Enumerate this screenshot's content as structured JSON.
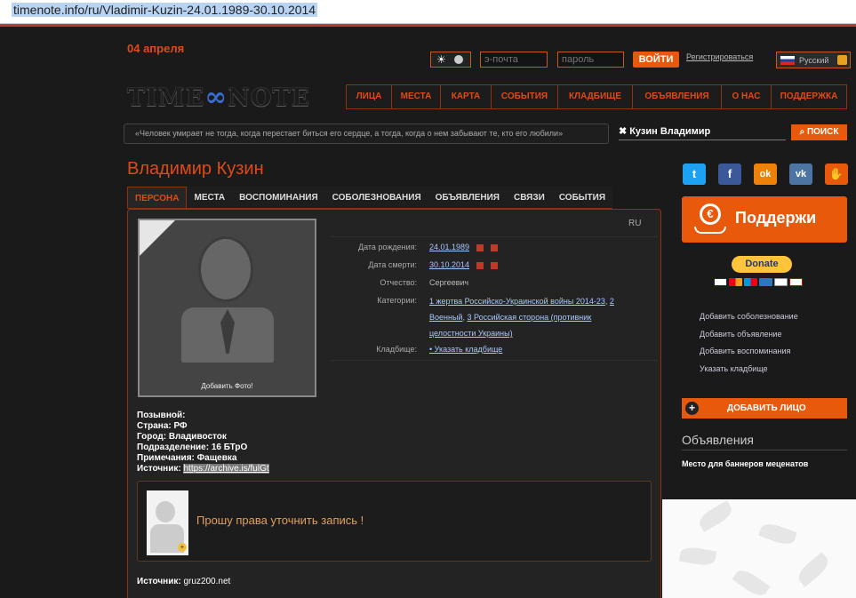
{
  "browser": {
    "url": "timenote.info/ru/Vladimir-Kuzin-24.01.1989-30.10.2014"
  },
  "header": {
    "date": "04 апреля",
    "email_placeholder": "э-почта",
    "password_placeholder": "пароль",
    "login_label": "ВОЙТИ",
    "register_label": "Регистрироваться",
    "language": "Русский",
    "logo_left": "TIME",
    "logo_symbol": "∞",
    "logo_right": "NOTE"
  },
  "nav": [
    "ЛИЦА",
    "МЕСТА",
    "КАРТА",
    "СОБЫТИЯ",
    "КЛАДБИЩЕ",
    "ОБЪЯВЛЕНИЯ",
    "О НАС",
    "ПОДДЕРЖКА"
  ],
  "quote": "«Человек умирает не тогда, когда перестает биться его сердце, а тогда, когда о нем забывают те, кто его любили»",
  "search": {
    "value": "Кузин Владимир",
    "button": "ПОИСК",
    "clear_icon": "x-icon"
  },
  "person": {
    "name": "Владимир Кузин",
    "tabs": [
      "ПЕРСОНА",
      "МЕСТА",
      "ВОСПОМИНАНИЯ",
      "СОБОЛЕЗНОВАНИЯ",
      "ОБЪЯВЛЕНИЯ",
      "СВЯЗИ",
      "СОБЫТИЯ"
    ],
    "lang": "RU",
    "add_photo": "Добавить Фото!",
    "fields": {
      "birth_label": "Дата рождения:",
      "birth": "24.01.1989",
      "death_label": "Дата смерти:",
      "death": "30.10.2014",
      "patronymic_label": "Отчество:",
      "patronymic": "Сергеевич",
      "categories_label": "Категории:",
      "cat1": "1 жертва Российско-Украинской войны 2014-23",
      "cat2": "2 Военный",
      "cat3": "3 Российская сторона (противник целостности Украины)",
      "cemetery_label": "Кладбище:",
      "cemetery": "• Указать кладбище"
    },
    "details": {
      "callsign": "Позывной:",
      "country": "Страна: РФ",
      "city": "Город: Владивосток",
      "unit": "Подразделение: 16 БТрО",
      "notes": "Примечания: Фащевка",
      "source_label": "Источник:",
      "source": "https://archive.is/fulGt"
    },
    "card_message": "Прошу права уточнить запись !",
    "source2_label": "Источник:",
    "source2": "gruz200.net"
  },
  "sidebar": {
    "social": [
      {
        "name": "twitter-icon",
        "glyph": "t",
        "color": "#1da1f2"
      },
      {
        "name": "facebook-icon",
        "glyph": "f",
        "color": "#3b5998"
      },
      {
        "name": "odnoklassniki-icon",
        "glyph": "ok",
        "color": "#ee8208"
      },
      {
        "name": "vk-icon",
        "glyph": "vk",
        "color": "#4c75a3"
      },
      {
        "name": "hand-icon",
        "glyph": "✋",
        "color": "#e8590c"
      }
    ],
    "support": "Поддержи",
    "donate": "Donate",
    "links": [
      "Добавить соболезнование",
      "Добавить объявление",
      "Добавить воспоминания",
      "Указать кладбище"
    ],
    "add_face": "ДОБАВИТЬ ЛИЦО",
    "ads_title": "Объявления",
    "banner": "Место для баннеров меценатов"
  },
  "colors": {
    "accent": "#e8590c",
    "title": "#e04a16",
    "border": "#8d3312"
  }
}
